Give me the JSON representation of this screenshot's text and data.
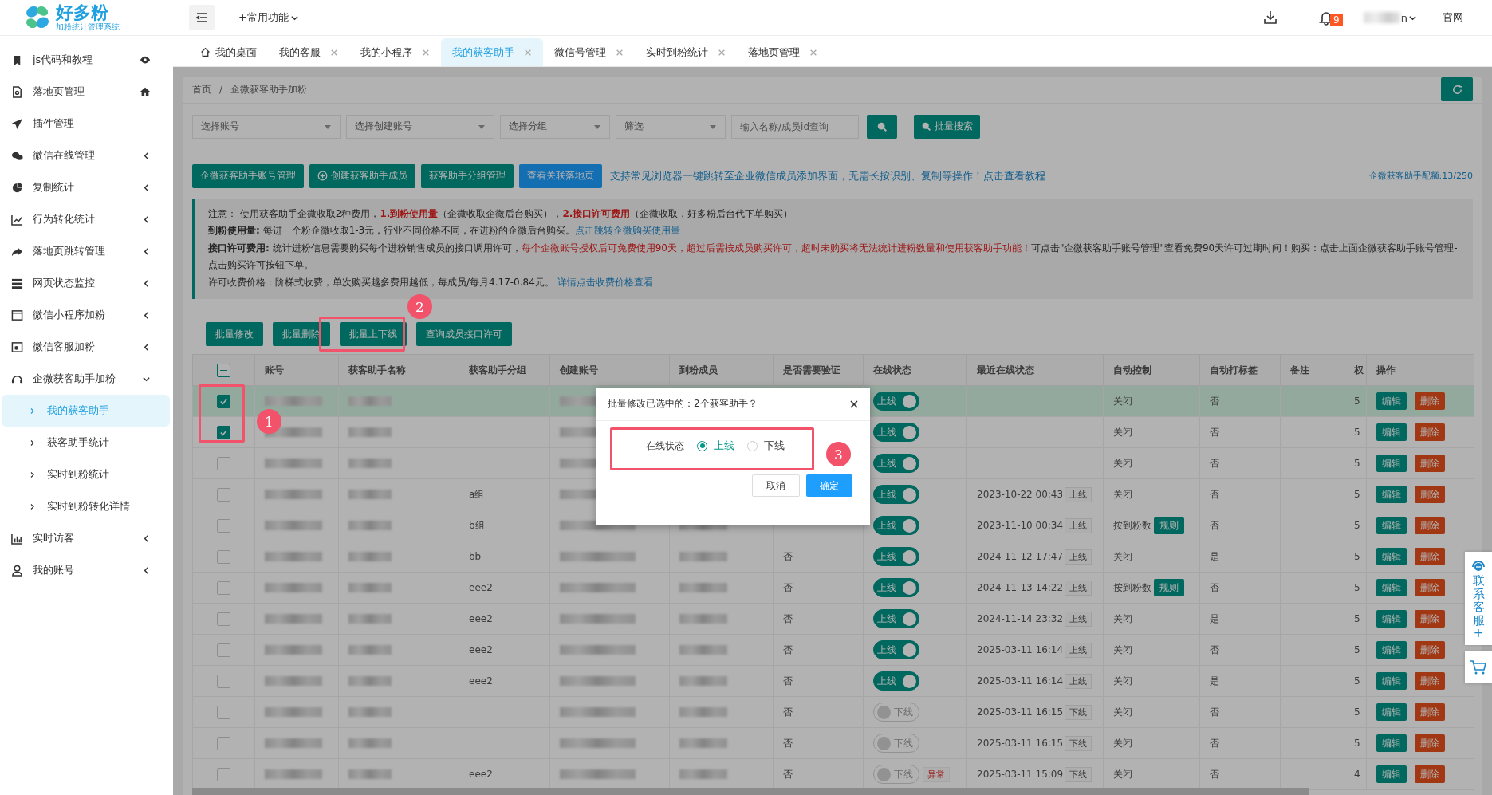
{
  "header": {
    "logo_title": "好多粉",
    "logo_subtitle": "加粉统计管理系统",
    "quick_menu": "+常用功能",
    "notification_count": "9",
    "user": "n",
    "website": "官网"
  },
  "sidebar": {
    "items": [
      {
        "label": "js代码和教程",
        "selected": false
      },
      {
        "label": "落地页管理",
        "selected": false
      },
      {
        "label": "插件管理",
        "selected": false
      },
      {
        "label": "微信在线管理",
        "selected": false,
        "expanded": false
      },
      {
        "label": "复制统计",
        "selected": false,
        "expanded": false
      },
      {
        "label": "行为转化统计",
        "selected": false,
        "expanded": false
      },
      {
        "label": "落地页跳转管理",
        "selected": false,
        "expanded": false
      },
      {
        "label": "网页状态监控",
        "selected": false,
        "expanded": false
      },
      {
        "label": "微信小程序加粉",
        "selected": false,
        "expanded": false
      },
      {
        "label": "微信客服加粉",
        "selected": false,
        "expanded": false
      },
      {
        "label": "企微获客助手加粉",
        "selected": false,
        "expanded": true,
        "children": [
          {
            "label": "我的获客助手",
            "selected": true
          },
          {
            "label": "获客助手统计",
            "selected": false
          },
          {
            "label": "实时到粉统计",
            "selected": false
          },
          {
            "label": "实时到粉转化详情",
            "selected": false
          }
        ]
      },
      {
        "label": "实时访客",
        "selected": false,
        "expanded": false
      },
      {
        "label": "我的账号",
        "selected": false,
        "expanded": false
      }
    ]
  },
  "tabs": [
    {
      "label": "我的桌面",
      "selected": false,
      "closable": false
    },
    {
      "label": "我的客服",
      "selected": false,
      "closable": true
    },
    {
      "label": "我的小程序",
      "selected": false,
      "closable": true
    },
    {
      "label": "我的获客助手",
      "selected": true,
      "closable": true
    },
    {
      "label": "微信号管理",
      "selected": false,
      "closable": true
    },
    {
      "label": "实时到粉统计",
      "selected": false,
      "closable": true
    },
    {
      "label": "落地页管理",
      "selected": false,
      "closable": true
    }
  ],
  "breadcrumb": {
    "items": [
      "首页",
      "企微获客助手加粉"
    ],
    "separator": "/"
  },
  "filters": {
    "dropdowns": [
      "选择账号",
      "选择创建账号",
      "选择分组",
      "筛选"
    ],
    "search_placeholder": "输入名称/成员id查询",
    "batch_search": "批量搜索"
  },
  "actions": {
    "buttons": [
      {
        "label": "企微获客助手账号管理",
        "kind": "teal"
      },
      {
        "label": "创建获客助手成员",
        "kind": "add"
      },
      {
        "label": "获客助手分组管理",
        "kind": "teal"
      },
      {
        "label": "查看关联落地页",
        "kind": "blue"
      }
    ],
    "tip_link": "支持常见浏览器一键跳转至企业微信成员添加界面，无需长按识别、复制等操作！点击查看教程",
    "quota": "企微获客助手配额:13/250"
  },
  "notice": [
    [
      {
        "text": "注意： 使用获客助手企微收取2种费用，",
        "kind": "plain"
      },
      {
        "text": "1.到粉使用量",
        "kind": "warning"
      },
      {
        "text": "（企微收取企微后台购买），",
        "kind": "plain"
      },
      {
        "text": "2.接口许可费用",
        "kind": "warning"
      },
      {
        "text": "（企微收取，好多粉后台代下单购买）",
        "kind": "plain"
      }
    ],
    [
      {
        "text": "到粉使用量:",
        "kind": "term"
      },
      {
        "text": " 每进一个粉企微收取1-3元，行业不同价格不同，在进粉的企微后台购买。",
        "kind": "plain"
      },
      {
        "text": "点击跳转企微购买使用量",
        "kind": "link"
      }
    ],
    [
      {
        "text": "接口许可费用:",
        "kind": "term"
      },
      {
        "text": " 统计进粉信息需要购买每个进粉销售成员的接口调用许可，",
        "kind": "plain"
      },
      {
        "text": "每个企微账号授权后可免费使用90天，超过后需按成员购买许可，超时未购买将无法统计进粉数量和使用获客助手功能！",
        "kind": "alert"
      },
      {
        "text": "可点击\"企微获客助手账号管理\"查看免费90天许可过期时间！购买：点击上面企微获客助手账号管理-点击购买许可按钮下单。",
        "kind": "plain"
      }
    ],
    [
      {
        "text": "许可收费价格：阶梯式收费，单次购买越多费用越低，每成员/每月4.17-0.84元。 ",
        "kind": "plain"
      },
      {
        "text": "详情点击收费价格查看",
        "kind": "link"
      }
    ]
  ],
  "bulk_buttons": [
    "批量修改",
    "批量删除",
    "批量上下线",
    "查询成员接口许可"
  ],
  "table": {
    "select_all_indeterminate": true,
    "columns": [
      "账号",
      "获客助手名称",
      "获客助手分组",
      "创建账号",
      "到粉成员",
      "是否需要验证",
      "在线状态",
      "最近在线状态",
      "自动控制",
      "自动打标签",
      "备注",
      "权",
      "操作"
    ],
    "rows": [
      {
        "checked": true,
        "selected": true,
        "online": true,
        "online_label": "上线",
        "auto_control": "关闭",
        "auto_tag": "否",
        "weight": "5",
        "edit": "编辑",
        "delete": "删除"
      },
      {
        "checked": true,
        "selected": false,
        "online": true,
        "online_label": "上线",
        "auto_control": "关闭",
        "auto_tag": "否",
        "weight": "5",
        "edit": "编辑",
        "delete": "删除"
      },
      {
        "checked": false,
        "selected": false,
        "online": true,
        "online_label": "上线",
        "auto_control": "关闭",
        "auto_tag": "否",
        "weight": "5",
        "edit": "编辑",
        "delete": "删除"
      },
      {
        "checked": false,
        "selected": false,
        "group": "a组",
        "online": true,
        "online_label": "上线",
        "recent_time": "2023-10-22 00:43",
        "recent_status": "上线",
        "auto_control": "关闭",
        "auto_tag": "否",
        "weight": "5",
        "edit": "编辑",
        "delete": "删除"
      },
      {
        "checked": false,
        "selected": false,
        "group": "b组",
        "online": true,
        "online_label": "上线",
        "recent_time": "2023-11-10 00:34",
        "recent_status": "上线",
        "auto_control": "按到粉数",
        "rule_button": "规则",
        "auto_tag": "否",
        "weight": "5",
        "edit": "编辑",
        "delete": "删除"
      },
      {
        "checked": false,
        "selected": false,
        "group": "bb",
        "verify": "否",
        "online": true,
        "online_label": "上线",
        "recent_time": "2024-11-12 17:47",
        "recent_status": "上线",
        "auto_control": "关闭",
        "auto_tag": "是",
        "weight": "5",
        "edit": "编辑",
        "delete": "删除"
      },
      {
        "checked": false,
        "selected": false,
        "group": "eee2",
        "verify": "否",
        "online": true,
        "online_label": "上线",
        "recent_time": "2024-11-13 14:22",
        "recent_status": "上线",
        "auto_control": "按到粉数",
        "rule_button": "规则",
        "auto_tag": "否",
        "weight": "5",
        "edit": "编辑",
        "delete": "删除"
      },
      {
        "checked": false,
        "selected": false,
        "group": "eee2",
        "verify": "否",
        "online": true,
        "online_label": "上线",
        "recent_time": "2024-11-14 23:32",
        "recent_status": "上线",
        "auto_control": "关闭",
        "auto_tag": "是",
        "weight": "5",
        "edit": "编辑",
        "delete": "删除"
      },
      {
        "checked": false,
        "selected": false,
        "group": "eee2",
        "verify": "否",
        "online": true,
        "online_label": "上线",
        "recent_time": "2025-03-11 16:14",
        "recent_status": "上线",
        "auto_control": "关闭",
        "auto_tag": "否",
        "weight": "5",
        "edit": "编辑",
        "delete": "删除"
      },
      {
        "checked": false,
        "selected": false,
        "group": "eee2",
        "verify": "否",
        "online": true,
        "online_label": "上线",
        "recent_time": "2025-03-11 16:14",
        "recent_status": "上线",
        "auto_control": "关闭",
        "auto_tag": "是",
        "weight": "5",
        "edit": "编辑",
        "delete": "删除"
      },
      {
        "checked": false,
        "selected": false,
        "verify": "否",
        "online": false,
        "online_label": "下线",
        "recent_time": "2025-03-11 16:15",
        "recent_status": "下线",
        "auto_control": "关闭",
        "auto_tag": "否",
        "weight": "5",
        "edit": "编辑",
        "delete": "删除"
      },
      {
        "checked": false,
        "selected": false,
        "verify": "否",
        "online": false,
        "online_label": "下线",
        "recent_time": "2025-03-11 16:15",
        "recent_status": "下线",
        "auto_control": "关闭",
        "auto_tag": "否",
        "weight": "5",
        "edit": "编辑",
        "delete": "删除"
      },
      {
        "checked": false,
        "selected": false,
        "group": "eee2",
        "verify": "否",
        "online": false,
        "online_label": "下线",
        "warning": "异常",
        "recent_time": "2025-03-11 15:09",
        "recent_status": "下线",
        "auto_control": "关闭",
        "auto_tag": "否",
        "weight": "4",
        "edit": "编辑",
        "delete": "删除"
      }
    ]
  },
  "modal": {
    "title": "批量修改已选中的：2个获客助手？",
    "field_label": "在线状态",
    "options": [
      {
        "label": "上线",
        "selected": true
      },
      {
        "label": "下线",
        "selected": false
      }
    ],
    "cancel": "取消",
    "confirm": "确定"
  },
  "annotations": [
    "1",
    "2",
    "3"
  ],
  "contact_widget": {
    "label": "联系客服+"
  }
}
